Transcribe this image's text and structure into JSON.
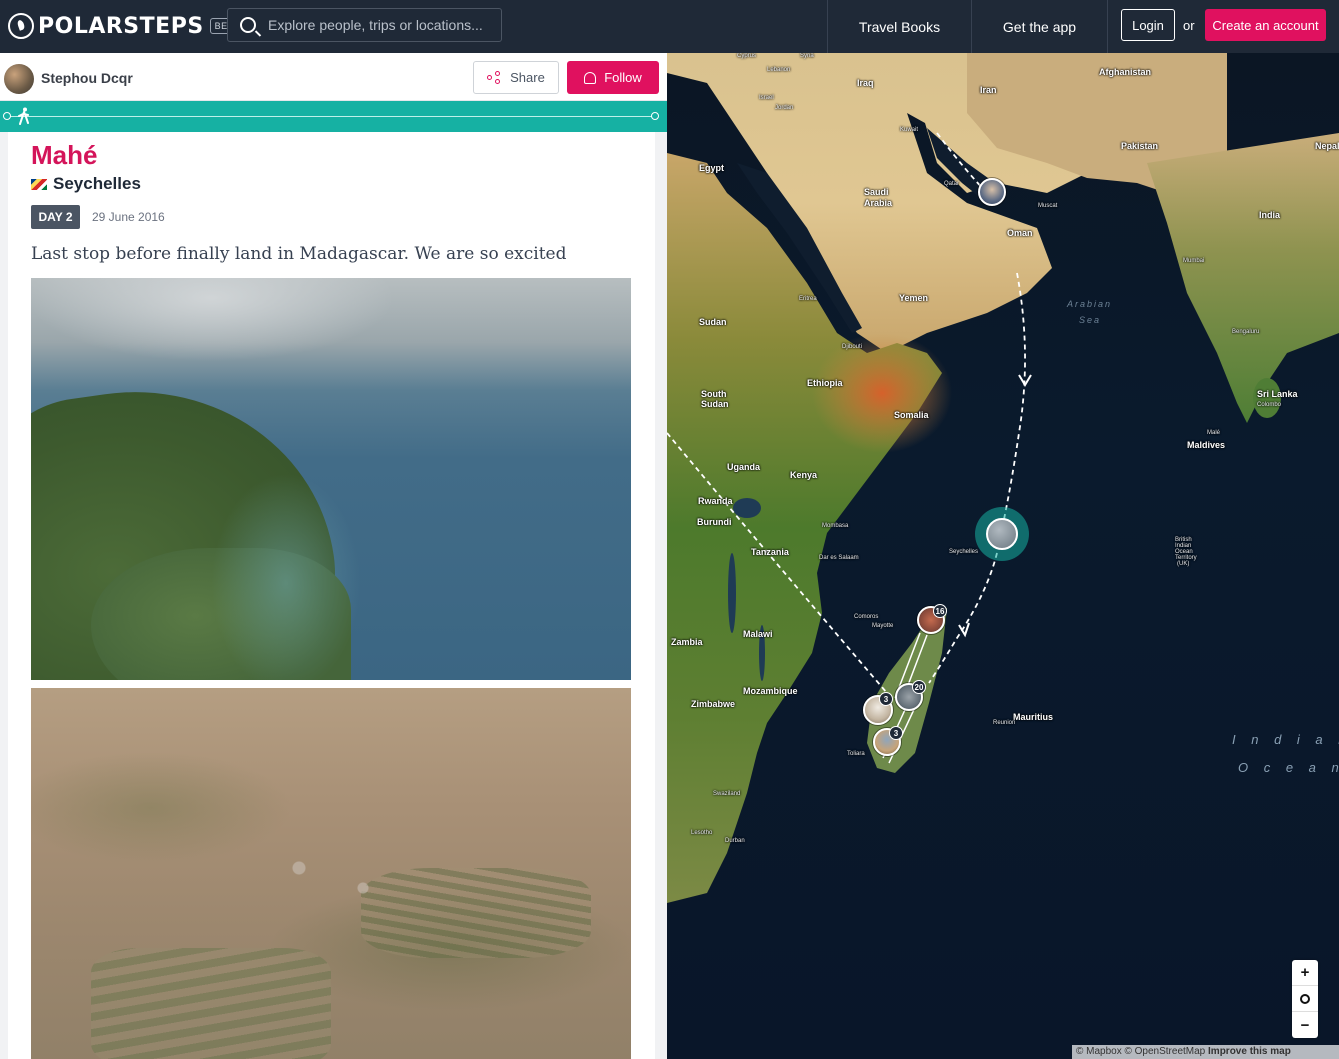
{
  "header": {
    "brand": "POLARSTEPS",
    "beta": "BETA",
    "search_placeholder": "Explore people, trips or locations...",
    "nav_travel_books": "Travel Books",
    "nav_get_app": "Get the app",
    "login": "Login",
    "or": "or",
    "create_account": "Create an account",
    "accent_color": "#e0115f"
  },
  "user": {
    "name": "Stephou Dcqr",
    "share": "Share",
    "follow": "Follow"
  },
  "step": {
    "title": "Mahé",
    "country": "Seychelles",
    "day": "DAY 2",
    "date": "29 June 2016",
    "caption": "Last stop before finally land in Madagascar. We are so excited"
  },
  "map": {
    "labels": {
      "cyprus": "Cyprus",
      "syria": "Syria",
      "lebanon": "Lebanon",
      "israel": "Israel",
      "jordan": "Jordan",
      "iraq": "Iraq",
      "iran": "Iran",
      "afghanistan": "Afghanistan",
      "kuwait": "Kuwait",
      "egypt": "Egypt",
      "saudi": "Saudi",
      "arabia": "Arabia",
      "qatar": "Qatar",
      "oman": "Oman",
      "pakistan": "Pakistan",
      "nepal": "Nepal",
      "india": "India",
      "yemen": "Yemen",
      "sudan": "Sudan",
      "eritrea": "Eritrea",
      "djibouti": "Djibouti",
      "ethiopia": "Ethiopia",
      "somalia": "Somalia",
      "south": "South",
      "sudan2": "Sudan",
      "uganda": "Uganda",
      "kenya": "Kenya",
      "rwanda": "Rwanda",
      "burundi": "Burundi",
      "tanzania": "Tanzania",
      "seychelles": "Seychelles",
      "comoros": "Comoros",
      "zambia": "Zambia",
      "malawi": "Malawi",
      "mozambique": "Mozambique",
      "zimbabwe": "Zimbabwe",
      "mauritius": "Mauritius",
      "swaziland": "Swaziland",
      "lesotho": "Lesotho",
      "maldives": "Maldives",
      "sri_lanka": "Sri Lanka",
      "bengaluru": "Bengaluru",
      "mumbai": "Mumbai",
      "arabian": "Arabian",
      "sea": "Sea",
      "indian": "I n d i a n",
      "ocean": "O c e a n",
      "british1": "British",
      "british2": "Indian",
      "british3": "Ocean",
      "british4": "Territory",
      "british5": "(UK)",
      "toliara": "Toliara",
      "dar": "Dar es Salaam",
      "mombasa": "Mombasa",
      "muscat": "Muscat",
      "reunion": "Reunion",
      "mayotte": "Mayotte",
      "durban": "Durban",
      "colombo": "Colombo",
      "male": "Malé"
    },
    "markers": {
      "c16": "16",
      "c20": "20",
      "c3a": "3",
      "c3b": "3"
    },
    "zoom_in": "+",
    "zoom_out": "−",
    "attribution_1": "© Mapbox © OpenStreetMap ",
    "attribution_2": "Improve this map"
  }
}
